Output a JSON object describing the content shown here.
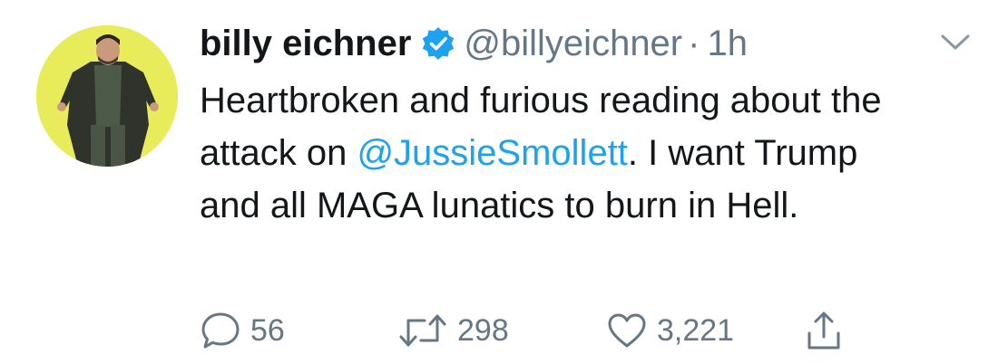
{
  "tweet": {
    "author": {
      "display_name": "billy eichner",
      "handle": "@billyeichner",
      "verified": true,
      "avatar_icon": "profile-photo"
    },
    "separator": "·",
    "time": "1h",
    "text": {
      "part1": "Heartbroken and furious reading about the attack on ",
      "mention": "@JussieSmollett",
      "part2": ". I want Trump and all MAGA lunatics to burn in Hell."
    },
    "actions": {
      "reply": {
        "icon": "reply-icon",
        "count": "56"
      },
      "retweet": {
        "icon": "retweet-icon",
        "count": "298"
      },
      "like": {
        "icon": "heart-icon",
        "count": "3,221"
      },
      "share": {
        "icon": "share-icon"
      }
    },
    "menu_icon": "chevron-down-icon"
  },
  "colors": {
    "text": "#14171a",
    "secondary": "#657786",
    "link": "#1da1f2",
    "verified": "#1da1f2",
    "background": "#ffffff"
  }
}
